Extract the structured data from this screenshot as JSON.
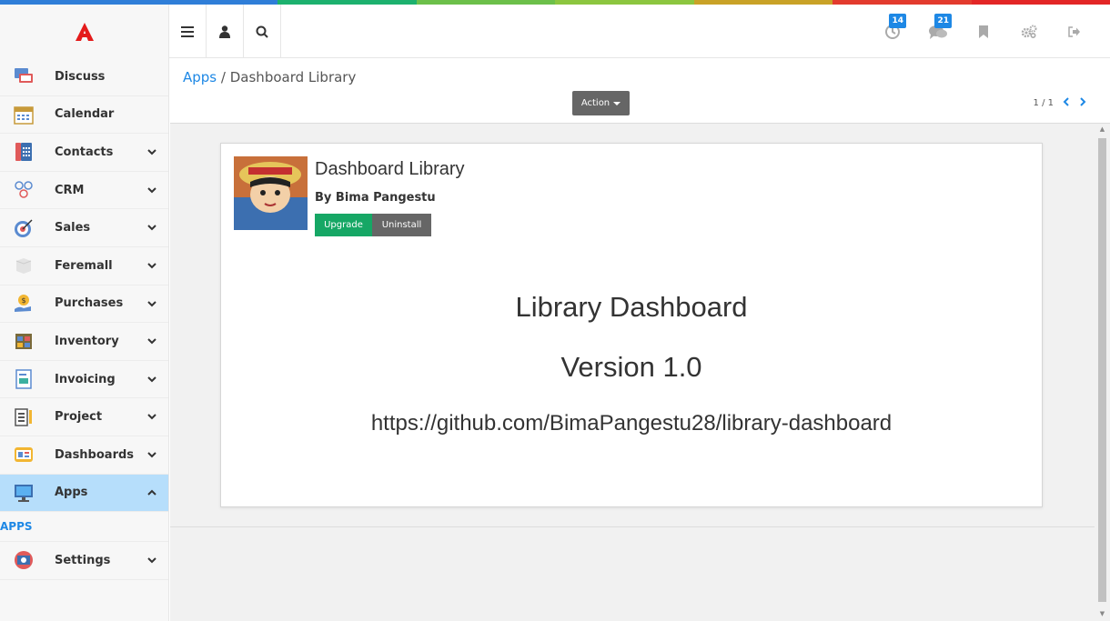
{
  "colors": {
    "strip": [
      "#2f7ed8",
      "#2f7ed8",
      "#1cb16e",
      "#6cc04a",
      "#8cc63f",
      "#c9a227",
      "#e33b2e",
      "#e32626"
    ],
    "brand": "#e41b1b",
    "accent": "#1e88e5",
    "active_bg": "#b6defb",
    "upgrade": "#16a765"
  },
  "topbar": {
    "left_icons": [
      "menu-icon",
      "user-icon",
      "search-icon"
    ],
    "activity_badge": "14",
    "messages_badge": "21",
    "right_icons": [
      "activity-icon",
      "chat-icon",
      "bookmark-icon",
      "settings-icon",
      "logout-icon"
    ]
  },
  "sidebar": {
    "items": [
      {
        "label": "Discuss",
        "icon": "discuss-icon",
        "chevron": ""
      },
      {
        "label": "Calendar",
        "icon": "calendar-icon",
        "chevron": ""
      },
      {
        "label": "Contacts",
        "icon": "contacts-icon",
        "chevron": "down"
      },
      {
        "label": "CRM",
        "icon": "crm-icon",
        "chevron": "down"
      },
      {
        "label": "Sales",
        "icon": "sales-icon",
        "chevron": "down"
      },
      {
        "label": "Feremall",
        "icon": "feremall-icon",
        "chevron": "down"
      },
      {
        "label": "Purchases",
        "icon": "purchases-icon",
        "chevron": "down"
      },
      {
        "label": "Inventory",
        "icon": "inventory-icon",
        "chevron": "down"
      },
      {
        "label": "Invoicing",
        "icon": "invoicing-icon",
        "chevron": "down"
      },
      {
        "label": "Project",
        "icon": "project-icon",
        "chevron": "down"
      },
      {
        "label": "Dashboards",
        "icon": "dashboards-icon",
        "chevron": "down"
      },
      {
        "label": "Apps",
        "icon": "apps-icon",
        "chevron": "up"
      },
      {
        "label": "Settings",
        "icon": "settings-app-icon",
        "chevron": "down"
      }
    ],
    "sub_item": "APPS"
  },
  "breadcrumb": {
    "parent": "Apps",
    "separator": "/",
    "current": "Dashboard Library"
  },
  "control": {
    "action_label": "Action",
    "pager": "1 / 1"
  },
  "module": {
    "title": "Dashboard Library",
    "author": "By Bima Pangestu",
    "upgrade_label": "Upgrade",
    "uninstall_label": "Uninstall",
    "desc_title": "Library Dashboard",
    "desc_version": "Version 1.0",
    "desc_url": "https://github.com/BimaPangestu28/library-dashboard"
  }
}
